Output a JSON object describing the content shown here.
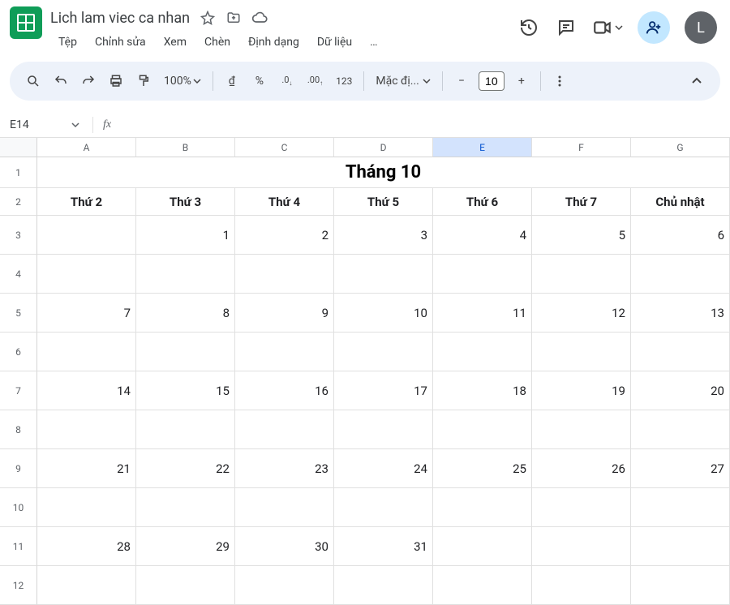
{
  "doc": {
    "title": "Lich lam viec ca nhan"
  },
  "menubar": {
    "file": "Tệp",
    "edit": "Chỉnh sửa",
    "view": "Xem",
    "insert": "Chèn",
    "format": "Định dạng",
    "data": "Dữ liệu",
    "more": "…"
  },
  "avatar": {
    "initial": "L"
  },
  "toolbar": {
    "zoom": "100%",
    "currency": "₫",
    "percent": "%",
    "dec_dec": ".0",
    "dec_inc": ".00",
    "num123": "123",
    "font": "Mặc đị...",
    "font_size": "10"
  },
  "fx": {
    "name_box": "E14",
    "fx_label": "fx",
    "formula": ""
  },
  "grid": {
    "col_headers": [
      "A",
      "B",
      "C",
      "D",
      "E",
      "F",
      "G"
    ],
    "selected_col_index": 4,
    "row_headers": [
      "1",
      "2",
      "3",
      "4",
      "5",
      "6",
      "7",
      "8",
      "9",
      "10",
      "11",
      "12"
    ],
    "month_title": "Tháng 10",
    "day_headers": [
      "Thứ 2",
      "Thứ 3",
      "Thứ 4",
      "Thứ 5",
      "Thứ 6",
      "Thứ 7",
      "Chủ nhật"
    ],
    "weeks": [
      [
        "",
        "1",
        "2",
        "3",
        "4",
        "5",
        "6"
      ],
      [
        "7",
        "8",
        "9",
        "10",
        "11",
        "12",
        "13"
      ],
      [
        "14",
        "15",
        "16",
        "17",
        "18",
        "19",
        "20"
      ],
      [
        "21",
        "22",
        "23",
        "24",
        "25",
        "26",
        "27"
      ],
      [
        "28",
        "29",
        "30",
        "31",
        "",
        "",
        ""
      ]
    ]
  }
}
